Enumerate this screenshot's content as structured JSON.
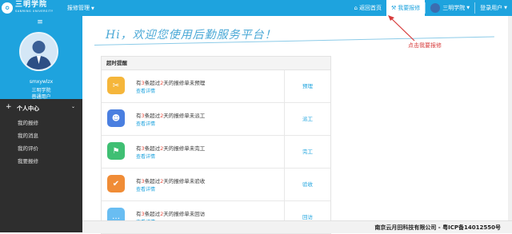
{
  "header": {
    "logo_text": "三明学院",
    "logo_sub": "SANMING UNIVERSITY",
    "menu_label": "报修管理",
    "nav": [
      {
        "label": "返回首页",
        "icon": "home-icon"
      },
      {
        "label": "我要报修",
        "icon": "wrench-icon"
      },
      {
        "label": "三明学院",
        "icon": "avatar"
      },
      {
        "label": "登录用户",
        "icon": "chevron-down-icon"
      }
    ],
    "accent": "#1ea3de"
  },
  "sidebar": {
    "username": "smxywlzx",
    "school": "三明学院",
    "role": "普通用户",
    "section_label": "个人中心",
    "items": [
      {
        "label": "我的报修"
      },
      {
        "label": "我的消息"
      },
      {
        "label": "我的评价"
      },
      {
        "label": "我要报修"
      }
    ]
  },
  "welcome": "Hi，欢迎您使用后勤服务平台！",
  "annotation": "点击我要报修",
  "panel": {
    "title": "超时提醒",
    "rows": [
      {
        "prefix": "有",
        "count": "3",
        "mid": "条超过",
        "days": "2",
        "suffix": "天的报修单未预理",
        "link": "查看详情",
        "action": "预理",
        "color": "#f5b63b",
        "icon": "wrench-icon"
      },
      {
        "prefix": "有",
        "count": "3",
        "mid": "条超过",
        "days": "2",
        "suffix": "天的报修单未派工",
        "link": "查看详情",
        "action": "派工",
        "color": "#4a7fe0",
        "icon": "worker-icon"
      },
      {
        "prefix": "有",
        "count": "3",
        "mid": "条超过",
        "days": "2",
        "suffix": "天的报修单未完工",
        "link": "查看详情",
        "action": "完工",
        "color": "#3fbf73",
        "icon": "flag-icon"
      },
      {
        "prefix": "有",
        "count": "3",
        "mid": "条超过",
        "days": "2",
        "suffix": "天的报修单未验收",
        "link": "查看详情",
        "action": "验收",
        "color": "#f08c36",
        "icon": "check-doc-icon"
      },
      {
        "prefix": "有",
        "count": "3",
        "mid": "条超过",
        "days": "2",
        "suffix": "天的报修单未回访",
        "link": "查看详情",
        "action": "回访",
        "color": "#69bdf2",
        "icon": "chat-icon"
      }
    ]
  },
  "footer": "南京云月田科技有限公司 - 粤ICP备14012550号"
}
